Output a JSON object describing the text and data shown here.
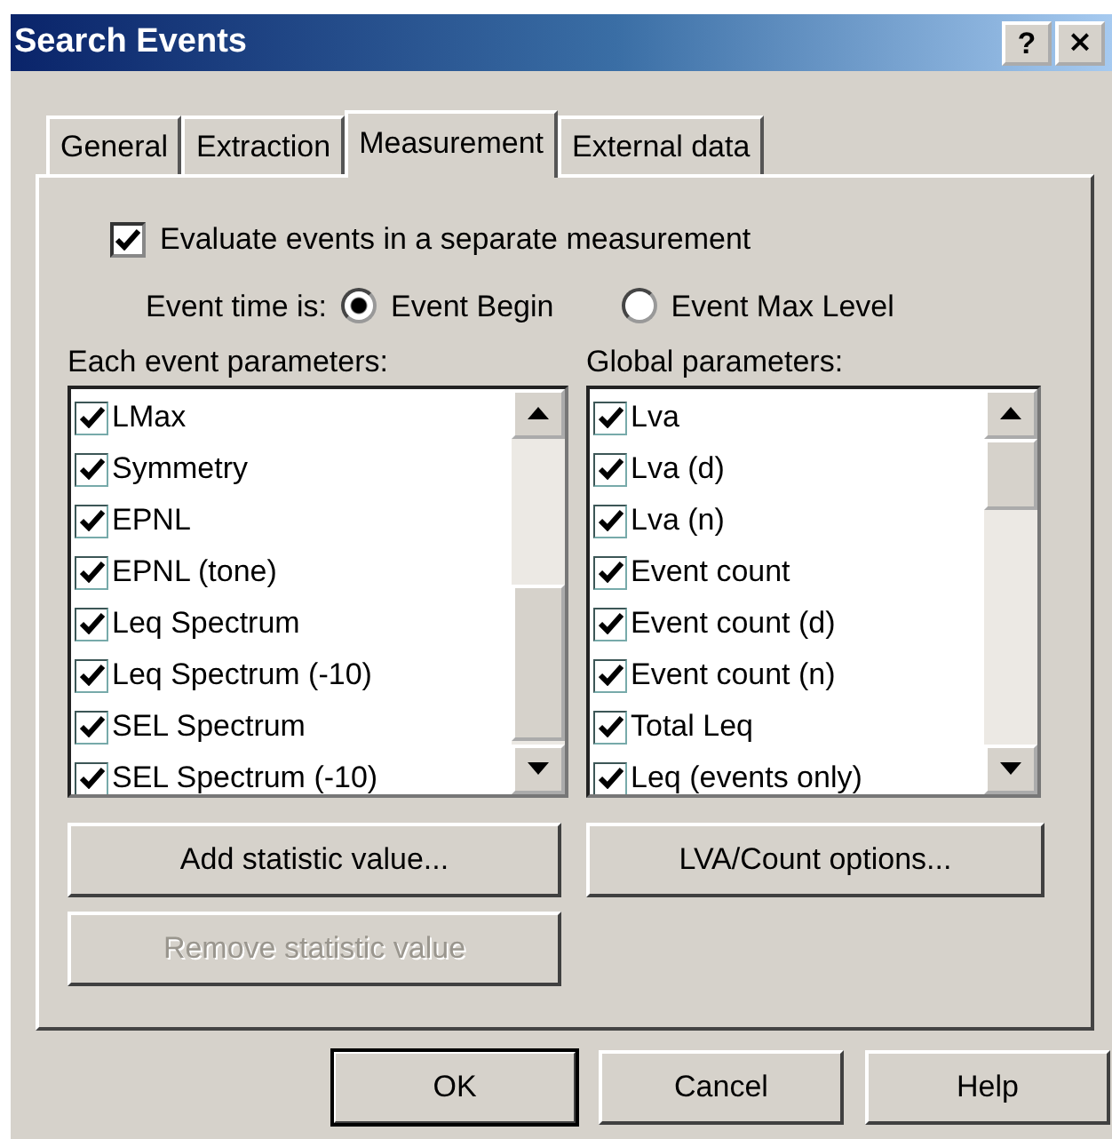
{
  "window": {
    "title": "Search Events",
    "buttons": [
      {
        "kind": "help",
        "label": "?"
      },
      {
        "kind": "close",
        "label": "×"
      }
    ]
  },
  "tabs": [
    {
      "label": "General",
      "selected": false
    },
    {
      "label": "Extraction",
      "selected": false
    },
    {
      "label": "Measurement",
      "selected": true
    },
    {
      "label": "External data",
      "selected": false
    }
  ],
  "evaluate_separately": {
    "label": "Evaluate events in a separate measurement",
    "checked": true
  },
  "event_time": {
    "label": "Event time is:",
    "options": [
      {
        "label": "Event Begin",
        "selected": true
      },
      {
        "label": "Event Max Level",
        "selected": false
      }
    ]
  },
  "lists": [
    {
      "label": "Each event parameters:",
      "items": [
        {
          "label": "LMax",
          "checked": true
        },
        {
          "label": "Symmetry",
          "checked": true
        },
        {
          "label": "EPNL",
          "checked": true
        },
        {
          "label": "EPNL (tone)",
          "checked": true
        },
        {
          "label": "Leq Spectrum",
          "checked": true
        },
        {
          "label": "Leq Spectrum (-10)",
          "checked": true
        },
        {
          "label": "SEL Spectrum",
          "checked": true
        },
        {
          "label": "SEL Spectrum (-10)",
          "checked": true
        }
      ]
    },
    {
      "label": "Global parameters:",
      "items": [
        {
          "label": "Lva",
          "checked": true
        },
        {
          "label": "Lva (d)",
          "checked": true
        },
        {
          "label": "Lva (n)",
          "checked": true
        },
        {
          "label": "Event count",
          "checked": true
        },
        {
          "label": "Event count (d)",
          "checked": true
        },
        {
          "label": "Event count (n)",
          "checked": true
        },
        {
          "label": "Total Leq",
          "checked": true
        },
        {
          "label": "Leq (events only)",
          "checked": true
        }
      ]
    }
  ],
  "panel_buttons": [
    {
      "label": "Add statistic value...",
      "disabled": false
    },
    {
      "label": "LVA/Count options...",
      "disabled": false
    },
    {
      "label": "Remove statistic value",
      "disabled": true
    }
  ],
  "dialog_buttons": [
    {
      "label": "OK",
      "default": true
    },
    {
      "label": "Cancel",
      "default": false
    },
    {
      "label": "Help",
      "default": false
    }
  ]
}
